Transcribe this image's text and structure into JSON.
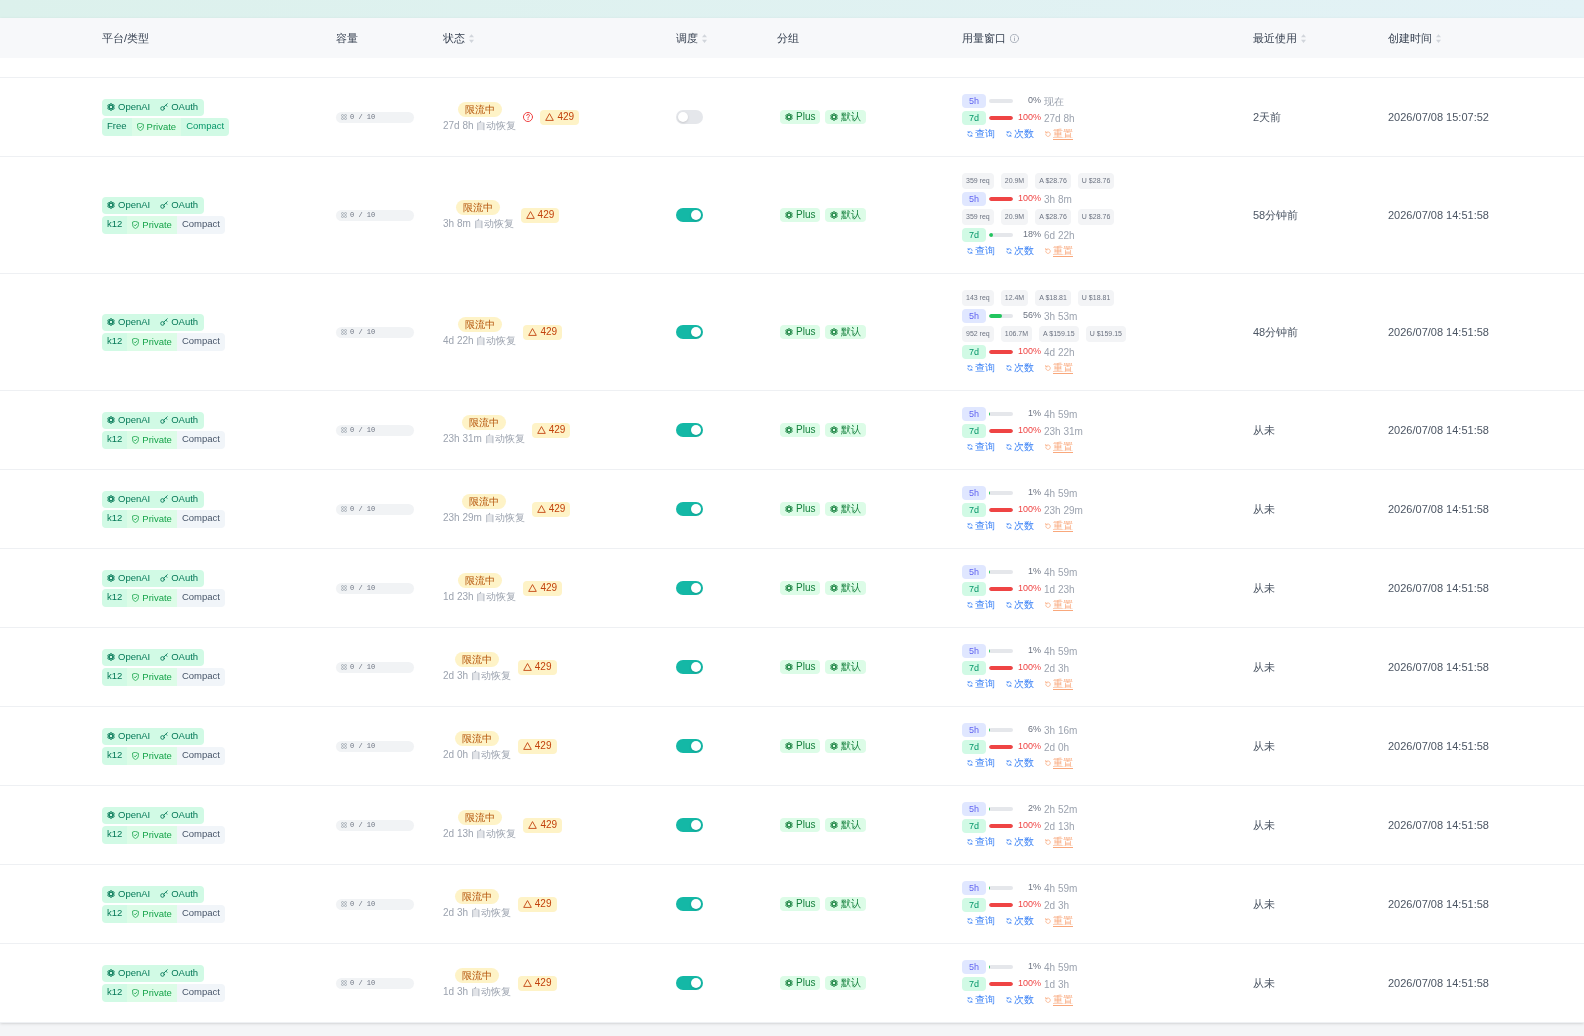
{
  "columns": [
    {
      "label": "平台/类型",
      "sortable": false,
      "info": false
    },
    {
      "label": "容量",
      "sortable": false,
      "info": false
    },
    {
      "label": "状态",
      "sortable": true,
      "info": false
    },
    {
      "label": "调度",
      "sortable": true,
      "info": false
    },
    {
      "label": "分组",
      "sortable": false,
      "info": false
    },
    {
      "label": "用量窗口",
      "sortable": false,
      "info": true
    },
    {
      "label": "最近使用",
      "sortable": true,
      "info": false
    },
    {
      "label": "创建时间",
      "sortable": true,
      "info": false
    }
  ],
  "rows": [
    {
      "platform": "OpenAI",
      "auth": "OAuth",
      "plan": "Free",
      "visibility": "Private",
      "mode": {
        "label": "Compact",
        "active": true
      },
      "capacity": "0 / 10",
      "status": {
        "label": "限流中",
        "recovery": "27d 8h 自动恢复",
        "help": true,
        "code": "429"
      },
      "schedulable": false,
      "groups": [
        "Plus",
        "默认"
      ],
      "windows": [
        {
          "kind": "short",
          "label": "5h",
          "level": 0,
          "percent": "0%",
          "reset": "现在",
          "exhausted": false
        },
        {
          "kind": "long",
          "label": "7d",
          "level": 1,
          "percent": "100%",
          "reset": "27d 8h",
          "exhausted": true
        }
      ],
      "actions": [
        {
          "kind": "query",
          "label": "查询"
        },
        {
          "kind": "count",
          "label": "次数"
        },
        {
          "kind": "reset",
          "label": "重置"
        }
      ],
      "last_used": "2天前",
      "created": "2026/07/08 15:07:52"
    },
    {
      "platform": "OpenAI",
      "auth": "OAuth",
      "plan": "k12",
      "visibility": "Private",
      "mode": {
        "label": "Compact",
        "active": false
      },
      "capacity": "0 / 10",
      "status": {
        "label": "限流中",
        "recovery": "3h 8m 自动恢复",
        "help": false,
        "code": "429"
      },
      "schedulable": true,
      "groups": [
        "Plus",
        "默认"
      ],
      "windows": [
        {
          "kind": "short",
          "label": "5h",
          "stats": [
            "359 req",
            "20.9M",
            "A $28.76",
            "U $28.76"
          ],
          "level": 1,
          "percent": "100%",
          "reset": "3h 8m",
          "exhausted": true
        },
        {
          "kind": "long",
          "label": "7d",
          "stats": [
            "359 req",
            "20.9M",
            "A $28.76",
            "U $28.76"
          ],
          "level": 0.18,
          "percent": "18%",
          "reset": "6d 22h",
          "exhausted": false
        }
      ],
      "actions": [
        {
          "kind": "query",
          "label": "查询"
        },
        {
          "kind": "count",
          "label": "次数"
        },
        {
          "kind": "reset",
          "label": "重置"
        }
      ],
      "last_used": "58分钟前",
      "created": "2026/07/08 14:51:58"
    },
    {
      "platform": "OpenAI",
      "auth": "OAuth",
      "plan": "k12",
      "visibility": "Private",
      "mode": {
        "label": "Compact",
        "active": false
      },
      "capacity": "0 / 10",
      "status": {
        "label": "限流中",
        "recovery": "4d 22h 自动恢复",
        "help": false,
        "code": "429"
      },
      "schedulable": true,
      "groups": [
        "Plus",
        "默认"
      ],
      "windows": [
        {
          "kind": "short",
          "label": "5h",
          "stats": [
            "143 req",
            "12.4M",
            "A $18.81",
            "U $18.81"
          ],
          "level": 0.56,
          "percent": "56%",
          "reset": "3h 53m",
          "exhausted": false
        },
        {
          "kind": "long",
          "label": "7d",
          "stats": [
            "952 req",
            "106.7M",
            "A $159.15",
            "U $159.15"
          ],
          "level": 1,
          "percent": "100%",
          "reset": "4d 22h",
          "exhausted": true
        }
      ],
      "actions": [
        {
          "kind": "query",
          "label": "查询"
        },
        {
          "kind": "count",
          "label": "次数"
        },
        {
          "kind": "reset",
          "label": "重置"
        }
      ],
      "last_used": "48分钟前",
      "created": "2026/07/08 14:51:58"
    },
    {
      "platform": "OpenAI",
      "auth": "OAuth",
      "plan": "k12",
      "visibility": "Private",
      "mode": {
        "label": "Compact",
        "active": false
      },
      "capacity": "0 / 10",
      "status": {
        "label": "限流中",
        "recovery": "23h 31m 自动恢复",
        "help": false,
        "code": "429"
      },
      "schedulable": true,
      "groups": [
        "Plus",
        "默认"
      ],
      "windows": [
        {
          "kind": "short",
          "label": "5h",
          "level": 0.01,
          "percent": "1%",
          "reset": "4h 59m",
          "exhausted": false
        },
        {
          "kind": "long",
          "label": "7d",
          "level": 1,
          "percent": "100%",
          "reset": "23h 31m",
          "exhausted": true
        }
      ],
      "actions": [
        {
          "kind": "query",
          "label": "查询"
        },
        {
          "kind": "count",
          "label": "次数"
        },
        {
          "kind": "reset",
          "label": "重置"
        }
      ],
      "last_used": "从未",
      "created": "2026/07/08 14:51:58"
    },
    {
      "platform": "OpenAI",
      "auth": "OAuth",
      "plan": "k12",
      "visibility": "Private",
      "mode": {
        "label": "Compact",
        "active": false
      },
      "capacity": "0 / 10",
      "status": {
        "label": "限流中",
        "recovery": "23h 29m 自动恢复",
        "help": false,
        "code": "429"
      },
      "schedulable": true,
      "groups": [
        "Plus",
        "默认"
      ],
      "windows": [
        {
          "kind": "short",
          "label": "5h",
          "level": 0.01,
          "percent": "1%",
          "reset": "4h 59m",
          "exhausted": false
        },
        {
          "kind": "long",
          "label": "7d",
          "level": 1,
          "percent": "100%",
          "reset": "23h 29m",
          "exhausted": true
        }
      ],
      "actions": [
        {
          "kind": "query",
          "label": "查询"
        },
        {
          "kind": "count",
          "label": "次数"
        },
        {
          "kind": "reset",
          "label": "重置"
        }
      ],
      "last_used": "从未",
      "created": "2026/07/08 14:51:58"
    },
    {
      "platform": "OpenAI",
      "auth": "OAuth",
      "plan": "k12",
      "visibility": "Private",
      "mode": {
        "label": "Compact",
        "active": false
      },
      "capacity": "0 / 10",
      "status": {
        "label": "限流中",
        "recovery": "1d 23h 自动恢复",
        "help": false,
        "code": "429"
      },
      "schedulable": true,
      "groups": [
        "Plus",
        "默认"
      ],
      "windows": [
        {
          "kind": "short",
          "label": "5h",
          "level": 0.01,
          "percent": "1%",
          "reset": "4h 59m",
          "exhausted": false
        },
        {
          "kind": "long",
          "label": "7d",
          "level": 1,
          "percent": "100%",
          "reset": "1d 23h",
          "exhausted": true
        }
      ],
      "actions": [
        {
          "kind": "query",
          "label": "查询"
        },
        {
          "kind": "count",
          "label": "次数"
        },
        {
          "kind": "reset",
          "label": "重置"
        }
      ],
      "last_used": "从未",
      "created": "2026/07/08 14:51:58"
    },
    {
      "platform": "OpenAI",
      "auth": "OAuth",
      "plan": "k12",
      "visibility": "Private",
      "mode": {
        "label": "Compact",
        "active": false
      },
      "capacity": "0 / 10",
      "status": {
        "label": "限流中",
        "recovery": "2d 3h 自动恢复",
        "help": false,
        "code": "429"
      },
      "schedulable": true,
      "groups": [
        "Plus",
        "默认"
      ],
      "windows": [
        {
          "kind": "short",
          "label": "5h",
          "level": 0.01,
          "percent": "1%",
          "reset": "4h 59m",
          "exhausted": false
        },
        {
          "kind": "long",
          "label": "7d",
          "level": 1,
          "percent": "100%",
          "reset": "2d 3h",
          "exhausted": true
        }
      ],
      "actions": [
        {
          "kind": "query",
          "label": "查询"
        },
        {
          "kind": "count",
          "label": "次数"
        },
        {
          "kind": "reset",
          "label": "重置"
        }
      ],
      "last_used": "从未",
      "created": "2026/07/08 14:51:58"
    },
    {
      "platform": "OpenAI",
      "auth": "OAuth",
      "plan": "k12",
      "visibility": "Private",
      "mode": {
        "label": "Compact",
        "active": false
      },
      "capacity": "0 / 10",
      "status": {
        "label": "限流中",
        "recovery": "2d 0h 自动恢复",
        "help": false,
        "code": "429"
      },
      "schedulable": true,
      "groups": [
        "Plus",
        "默认"
      ],
      "windows": [
        {
          "kind": "short",
          "label": "5h",
          "level": 0.06,
          "percent": "6%",
          "reset": "3h 16m",
          "exhausted": false
        },
        {
          "kind": "long",
          "label": "7d",
          "level": 1,
          "percent": "100%",
          "reset": "2d 0h",
          "exhausted": true
        }
      ],
      "actions": [
        {
          "kind": "query",
          "label": "查询"
        },
        {
          "kind": "count",
          "label": "次数"
        },
        {
          "kind": "reset",
          "label": "重置"
        }
      ],
      "last_used": "从未",
      "created": "2026/07/08 14:51:58"
    },
    {
      "platform": "OpenAI",
      "auth": "OAuth",
      "plan": "k12",
      "visibility": "Private",
      "mode": {
        "label": "Compact",
        "active": false
      },
      "capacity": "0 / 10",
      "status": {
        "label": "限流中",
        "recovery": "2d 13h 自动恢复",
        "help": false,
        "code": "429"
      },
      "schedulable": true,
      "groups": [
        "Plus",
        "默认"
      ],
      "windows": [
        {
          "kind": "short",
          "label": "5h",
          "level": 0.02,
          "percent": "2%",
          "reset": "2h 52m",
          "exhausted": false
        },
        {
          "kind": "long",
          "label": "7d",
          "level": 1,
          "percent": "100%",
          "reset": "2d 13h",
          "exhausted": true
        }
      ],
      "actions": [
        {
          "kind": "query",
          "label": "查询"
        },
        {
          "kind": "count",
          "label": "次数"
        },
        {
          "kind": "reset",
          "label": "重置"
        }
      ],
      "last_used": "从未",
      "created": "2026/07/08 14:51:58"
    },
    {
      "platform": "OpenAI",
      "auth": "OAuth",
      "plan": "k12",
      "visibility": "Private",
      "mode": {
        "label": "Compact",
        "active": false
      },
      "capacity": "0 / 10",
      "status": {
        "label": "限流中",
        "recovery": "2d 3h 自动恢复",
        "help": false,
        "code": "429"
      },
      "schedulable": true,
      "groups": [
        "Plus",
        "默认"
      ],
      "windows": [
        {
          "kind": "short",
          "label": "5h",
          "level": 0.01,
          "percent": "1%",
          "reset": "4h 59m",
          "exhausted": false
        },
        {
          "kind": "long",
          "label": "7d",
          "level": 1,
          "percent": "100%",
          "reset": "2d 3h",
          "exhausted": true
        }
      ],
      "actions": [
        {
          "kind": "query",
          "label": "查询"
        },
        {
          "kind": "count",
          "label": "次数"
        },
        {
          "kind": "reset",
          "label": "重置"
        }
      ],
      "last_used": "从未",
      "created": "2026/07/08 14:51:58"
    },
    {
      "platform": "OpenAI",
      "auth": "OAuth",
      "plan": "k12",
      "visibility": "Private",
      "mode": {
        "label": "Compact",
        "active": false
      },
      "capacity": "0 / 10",
      "status": {
        "label": "限流中",
        "recovery": "1d 3h 自动恢复",
        "help": false,
        "code": "429"
      },
      "schedulable": true,
      "groups": [
        "Plus",
        "默认"
      ],
      "windows": [
        {
          "kind": "short",
          "label": "5h",
          "level": 0.01,
          "percent": "1%",
          "reset": "4h 59m",
          "exhausted": false
        },
        {
          "kind": "long",
          "label": "7d",
          "level": 1,
          "percent": "100%",
          "reset": "1d 3h",
          "exhausted": true
        }
      ],
      "actions": [
        {
          "kind": "query",
          "label": "查询"
        },
        {
          "kind": "count",
          "label": "次数"
        },
        {
          "kind": "reset",
          "label": "重置"
        }
      ],
      "last_used": "从未",
      "created": "2026/07/08 14:51:58"
    }
  ]
}
